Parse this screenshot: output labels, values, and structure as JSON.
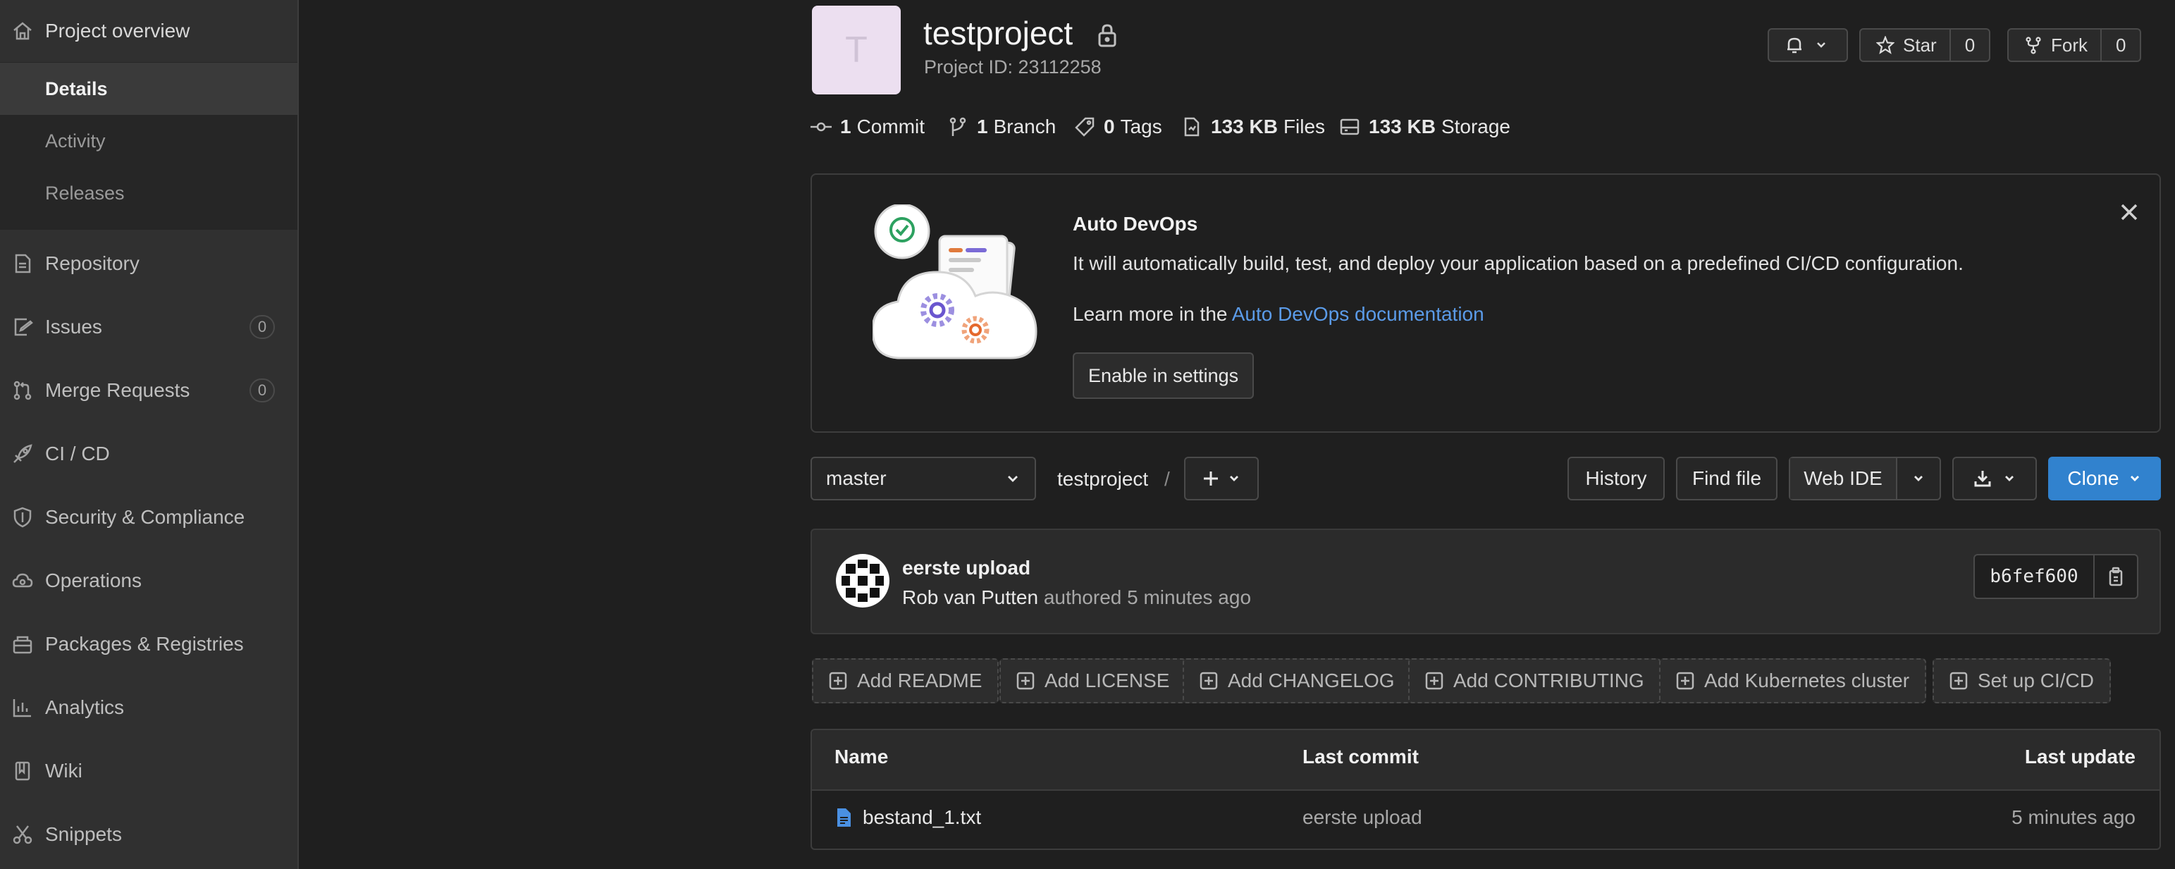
{
  "sidebar": {
    "project_overview": "Project overview",
    "sub_items": [
      "Details",
      "Activity",
      "Releases"
    ],
    "items": [
      {
        "label": "Repository",
        "icon": "document-icon"
      },
      {
        "label": "Issues",
        "icon": "issues-icon",
        "count": "0"
      },
      {
        "label": "Merge Requests",
        "icon": "merge-request-icon",
        "count": "0"
      },
      {
        "label": "CI / CD",
        "icon": "rocket-icon"
      },
      {
        "label": "Security & Compliance",
        "icon": "shield-icon"
      },
      {
        "label": "Operations",
        "icon": "cloud-gear-icon"
      },
      {
        "label": "Packages & Registries",
        "icon": "package-icon"
      },
      {
        "label": "Analytics",
        "icon": "chart-icon"
      },
      {
        "label": "Wiki",
        "icon": "book-icon"
      },
      {
        "label": "Snippets",
        "icon": "scissors-icon"
      }
    ]
  },
  "project": {
    "avatar_letter": "T",
    "name": "testproject",
    "id_text": "Project ID: 23112258"
  },
  "header_buttons": {
    "star_label": "Star",
    "star_count": "0",
    "fork_label": "Fork",
    "fork_count": "0"
  },
  "stats": {
    "commits_value": "1",
    "commits_label": "Commit",
    "branches_value": "1",
    "branches_label": "Branch",
    "tags_value": "0",
    "tags_label": "Tags",
    "files_value": "133 KB",
    "files_label": "Files",
    "storage_value": "133 KB",
    "storage_label": "Storage"
  },
  "devops": {
    "title": "Auto DevOps",
    "description": "It will automatically build, test, and deploy your application based on a predefined CI/CD configuration.",
    "learn_prefix": "Learn more in the ",
    "learn_link": "Auto DevOps documentation",
    "enable_button": "Enable in settings"
  },
  "toolbar": {
    "branch": "master",
    "path": "testproject",
    "separator": "/",
    "history": "History",
    "find_file": "Find file",
    "web_ide": "Web IDE",
    "clone": "Clone"
  },
  "commit": {
    "title": "eerste upload",
    "author": "Rob van Putten",
    "meta": "authored 5 minutes ago",
    "sha": "b6fef600"
  },
  "add_buttons": [
    "Add README",
    "Add LICENSE",
    "Add CHANGELOG",
    "Add CONTRIBUTING",
    "Add Kubernetes cluster",
    "Set up CI/CD"
  ],
  "file_table": {
    "headers": {
      "name": "Name",
      "last_commit": "Last commit",
      "last_update": "Last update"
    },
    "rows": [
      {
        "name": "bestand_1.txt",
        "last_commit": "eerste upload",
        "last_update": "5 minutes ago"
      }
    ]
  },
  "colors": {
    "accent": "#3182ce",
    "link": "#5b9be8",
    "background": "#1f1f1f",
    "sidebar": "#303030"
  }
}
